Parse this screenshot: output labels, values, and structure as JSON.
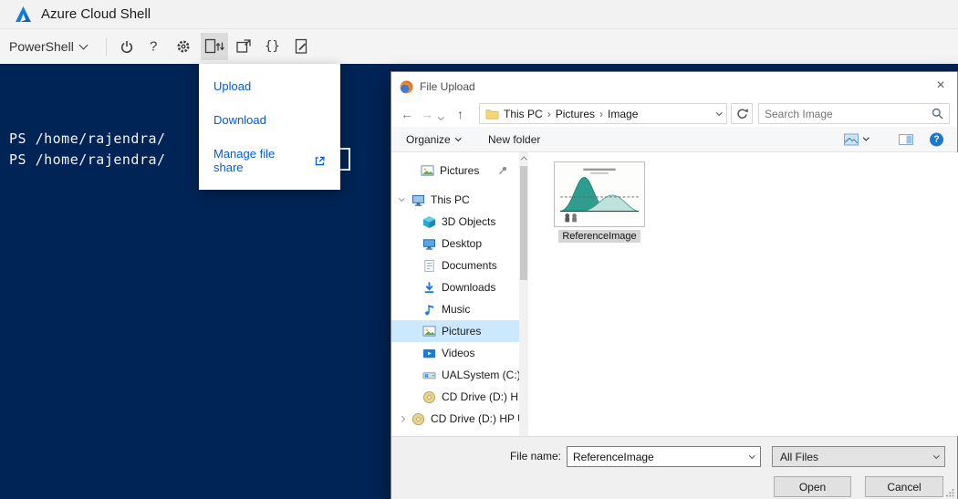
{
  "header": {
    "app_title": "Azure Cloud Shell"
  },
  "toolbar": {
    "shell_label": "PowerShell",
    "help_label": "?",
    "braces_label": "{}"
  },
  "terminal": {
    "line1": "PS /home/rajendra/",
    "line2": "PS /home/rajendra/"
  },
  "upload_menu": {
    "upload": "Upload",
    "download": "Download",
    "manage": "Manage file share"
  },
  "dialog": {
    "title": "File Upload",
    "close_glyph": "×",
    "nav": {
      "back_glyph": "←",
      "forward_glyph": "→",
      "up_glyph": "↑"
    },
    "breadcrumb": {
      "crumb1": "This PC",
      "crumb2": "Pictures",
      "crumb3": "Image",
      "separator": "›"
    },
    "search_placeholder": "Search Image",
    "commandbar": {
      "organize": "Organize",
      "new_folder": "New folder",
      "help_glyph": "?"
    },
    "sidebar": {
      "items": [
        {
          "label": "Pictures"
        },
        {
          "label": "This PC"
        },
        {
          "label": "3D Objects"
        },
        {
          "label": "Desktop"
        },
        {
          "label": "Documents"
        },
        {
          "label": "Downloads"
        },
        {
          "label": "Music"
        },
        {
          "label": "Pictures"
        },
        {
          "label": "Videos"
        },
        {
          "label": "UALSystem (C:)"
        },
        {
          "label": "CD Drive (D:) HP"
        },
        {
          "label": "CD Drive (D:) HP U"
        }
      ]
    },
    "files": {
      "item1_name": "ReferenceImage"
    },
    "footer": {
      "file_name_label": "File name:",
      "file_name_value": "ReferenceImage",
      "file_type_value": "All Files",
      "open_label": "Open",
      "cancel_label": "Cancel"
    }
  },
  "colors": {
    "terminal_bg": "#012456",
    "accent_blue": "#0078d4",
    "link_blue": "#015cda",
    "selection": "#cce8ff"
  }
}
